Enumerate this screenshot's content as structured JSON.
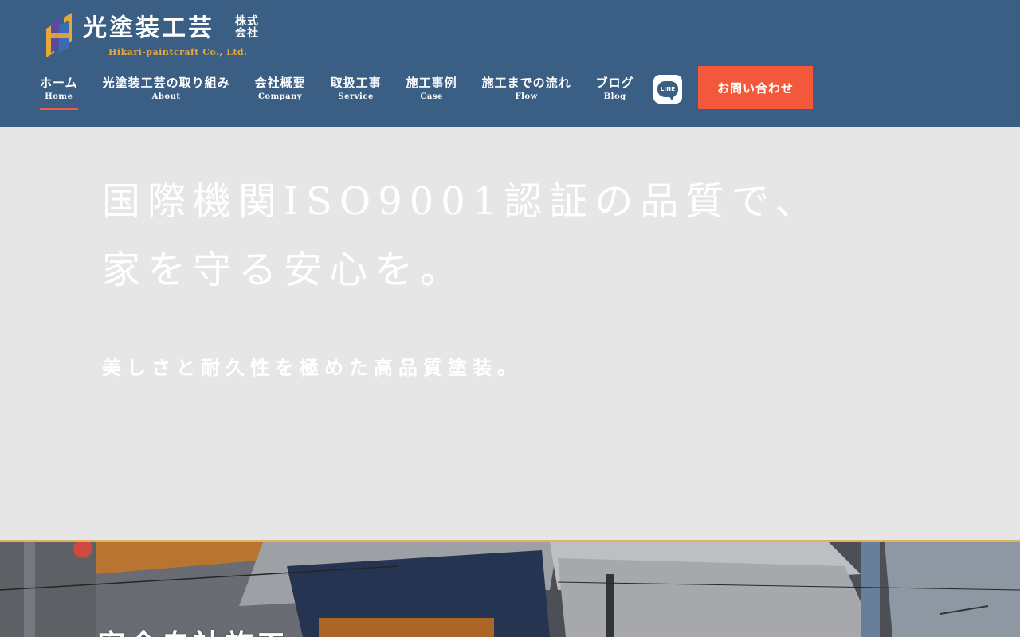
{
  "logo": {
    "name": "光塗装工芸",
    "corp_line1": "株式",
    "corp_line2": "会社",
    "english": "Hikari-paintcraft Co., Ltd."
  },
  "nav": [
    {
      "ja": "ホーム",
      "en": "Home",
      "active": true
    },
    {
      "ja": "光塗装工芸の取り組み",
      "en": "About",
      "active": false
    },
    {
      "ja": "会社概要",
      "en": "Company",
      "active": false
    },
    {
      "ja": "取扱工事",
      "en": "Service",
      "active": false
    },
    {
      "ja": "施工事例",
      "en": "Case",
      "active": false
    },
    {
      "ja": "施工までの流れ",
      "en": "Flow",
      "active": false
    },
    {
      "ja": "ブログ",
      "en": "Blog",
      "active": false
    }
  ],
  "line_button": {
    "label": "LINE",
    "icon": "line-icon"
  },
  "contact_button": {
    "label": "お問い合わせ"
  },
  "hero": {
    "title_line1": "国際機関ISO9001認証の品質で、",
    "title_line2": "家を守る安心を。",
    "subtitle": "美しさと耐久性を極めた高品質塗装。"
  },
  "case": {
    "title": "安全自社施工"
  },
  "colors": {
    "header_bg": "#3b5f84",
    "accent_orange": "#f4583a",
    "logo_gold": "#e8a73a",
    "hero_bg": "#e6e6e6",
    "divider_gold": "#e2b15e"
  }
}
